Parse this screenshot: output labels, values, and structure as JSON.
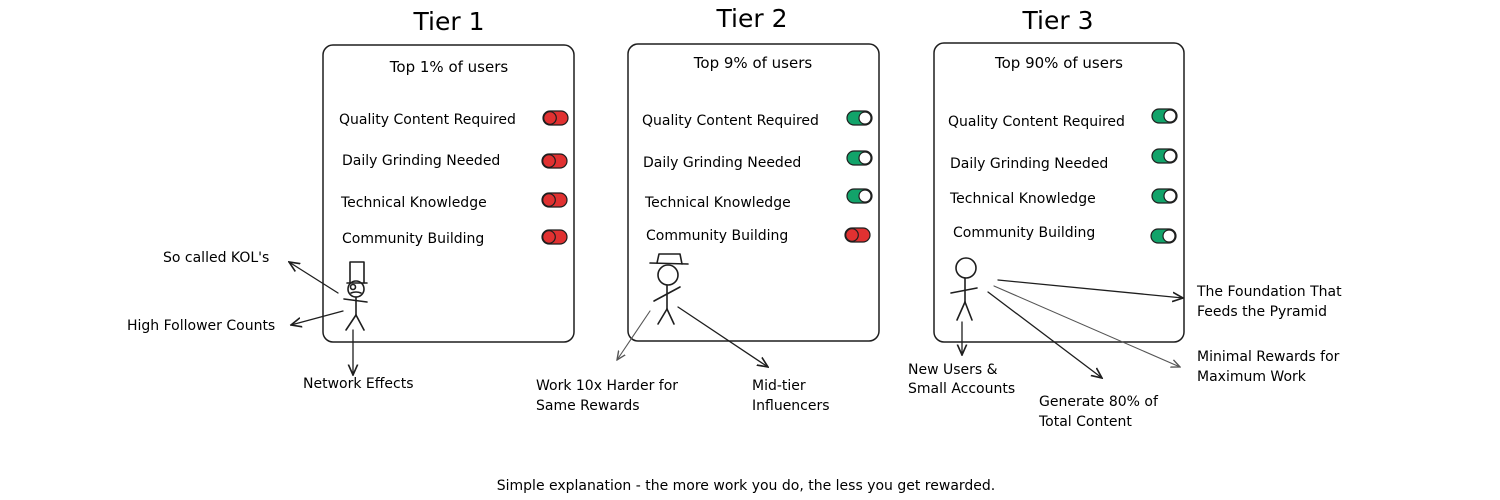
{
  "colors": {
    "on": "#12a36a",
    "off": "#e03131",
    "ink": "#1e1e1e"
  },
  "tiers": [
    {
      "title": "Tier 1",
      "subtitle": "Top 1% of users",
      "features": [
        {
          "label": "Quality Content Required",
          "on": false
        },
        {
          "label": "Daily Grinding Needed",
          "on": false
        },
        {
          "label": "Technical Knowledge",
          "on": false
        },
        {
          "label": "Community Building",
          "on": false
        }
      ]
    },
    {
      "title": "Tier 2",
      "subtitle": "Top 9% of users",
      "features": [
        {
          "label": "Quality Content Required",
          "on": true
        },
        {
          "label": "Daily Grinding Needed",
          "on": true
        },
        {
          "label": "Technical Knowledge",
          "on": true
        },
        {
          "label": "Community Building",
          "on": false
        }
      ]
    },
    {
      "title": "Tier 3",
      "subtitle": "Top 90% of users",
      "features": [
        {
          "label": "Quality Content Required",
          "on": true
        },
        {
          "label": "Daily Grinding Needed",
          "on": true
        },
        {
          "label": "Technical Knowledge",
          "on": true
        },
        {
          "label": "Community Building",
          "on": true
        }
      ]
    }
  ],
  "annotations": {
    "t1_kol": "So called KOL's",
    "t1_followers": "High Follower Counts",
    "t1_network": "Network Effects",
    "t2_work_line1": "Work 10x Harder for",
    "t2_work_line2": "Same Rewards",
    "t2_mid_line1": "Mid-tier",
    "t2_mid_line2": "Influencers",
    "t3_new_line1": "New Users &",
    "t3_new_line2": "Small Accounts",
    "t3_gen_line1": "Generate 80% of",
    "t3_gen_line2": "Total Content",
    "t3_min_line1": "Minimal Rewards for",
    "t3_min_line2": "Maximum Work",
    "t3_found_line1": "The Foundation That",
    "t3_found_line2": "Feeds the Pyramid"
  },
  "footer": "Simple explanation - the more work you do, the less you get rewarded."
}
